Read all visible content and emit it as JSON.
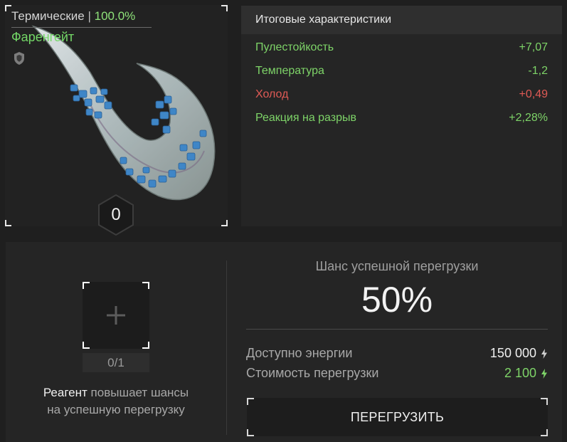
{
  "artifact": {
    "category": "Термические",
    "separator": "|",
    "percent": "100.0%",
    "name": "Фаренгейт",
    "level": "0",
    "icons": {
      "protection": "shield-icon",
      "image": "claw-artifact-image"
    }
  },
  "stats": {
    "title": "Итоговые характеристики",
    "rows": [
      {
        "name": "Пулестойкость",
        "value": "+7,07",
        "color": "#7ed468"
      },
      {
        "name": "Температура",
        "value": "-1,2",
        "color": "#7ed468"
      },
      {
        "name": "Холод",
        "value": "+0,49",
        "color": "#e05a55"
      },
      {
        "name": "Реакция на разрыв",
        "value": "+2,28%",
        "color": "#7ed468"
      }
    ]
  },
  "reagent": {
    "count": "0/1",
    "hint_strong": "Реагент",
    "hint_rest_line1": " повышает шансы",
    "hint_line2": "на успешную перегрузку",
    "icon": "plus-icon"
  },
  "overload": {
    "chance_label": "Шанс успешной перегрузки",
    "chance_value": "50%",
    "energy_label": "Доступно энергии",
    "energy_value": "150 000",
    "energy_color": "#f0f0f0",
    "cost_label": "Стоимость перегрузки",
    "cost_value": "2 100",
    "cost_color": "#7ed468",
    "button_label": "ПЕРЕГРУЗИТЬ",
    "icon": "lightning-bolt-icon"
  }
}
